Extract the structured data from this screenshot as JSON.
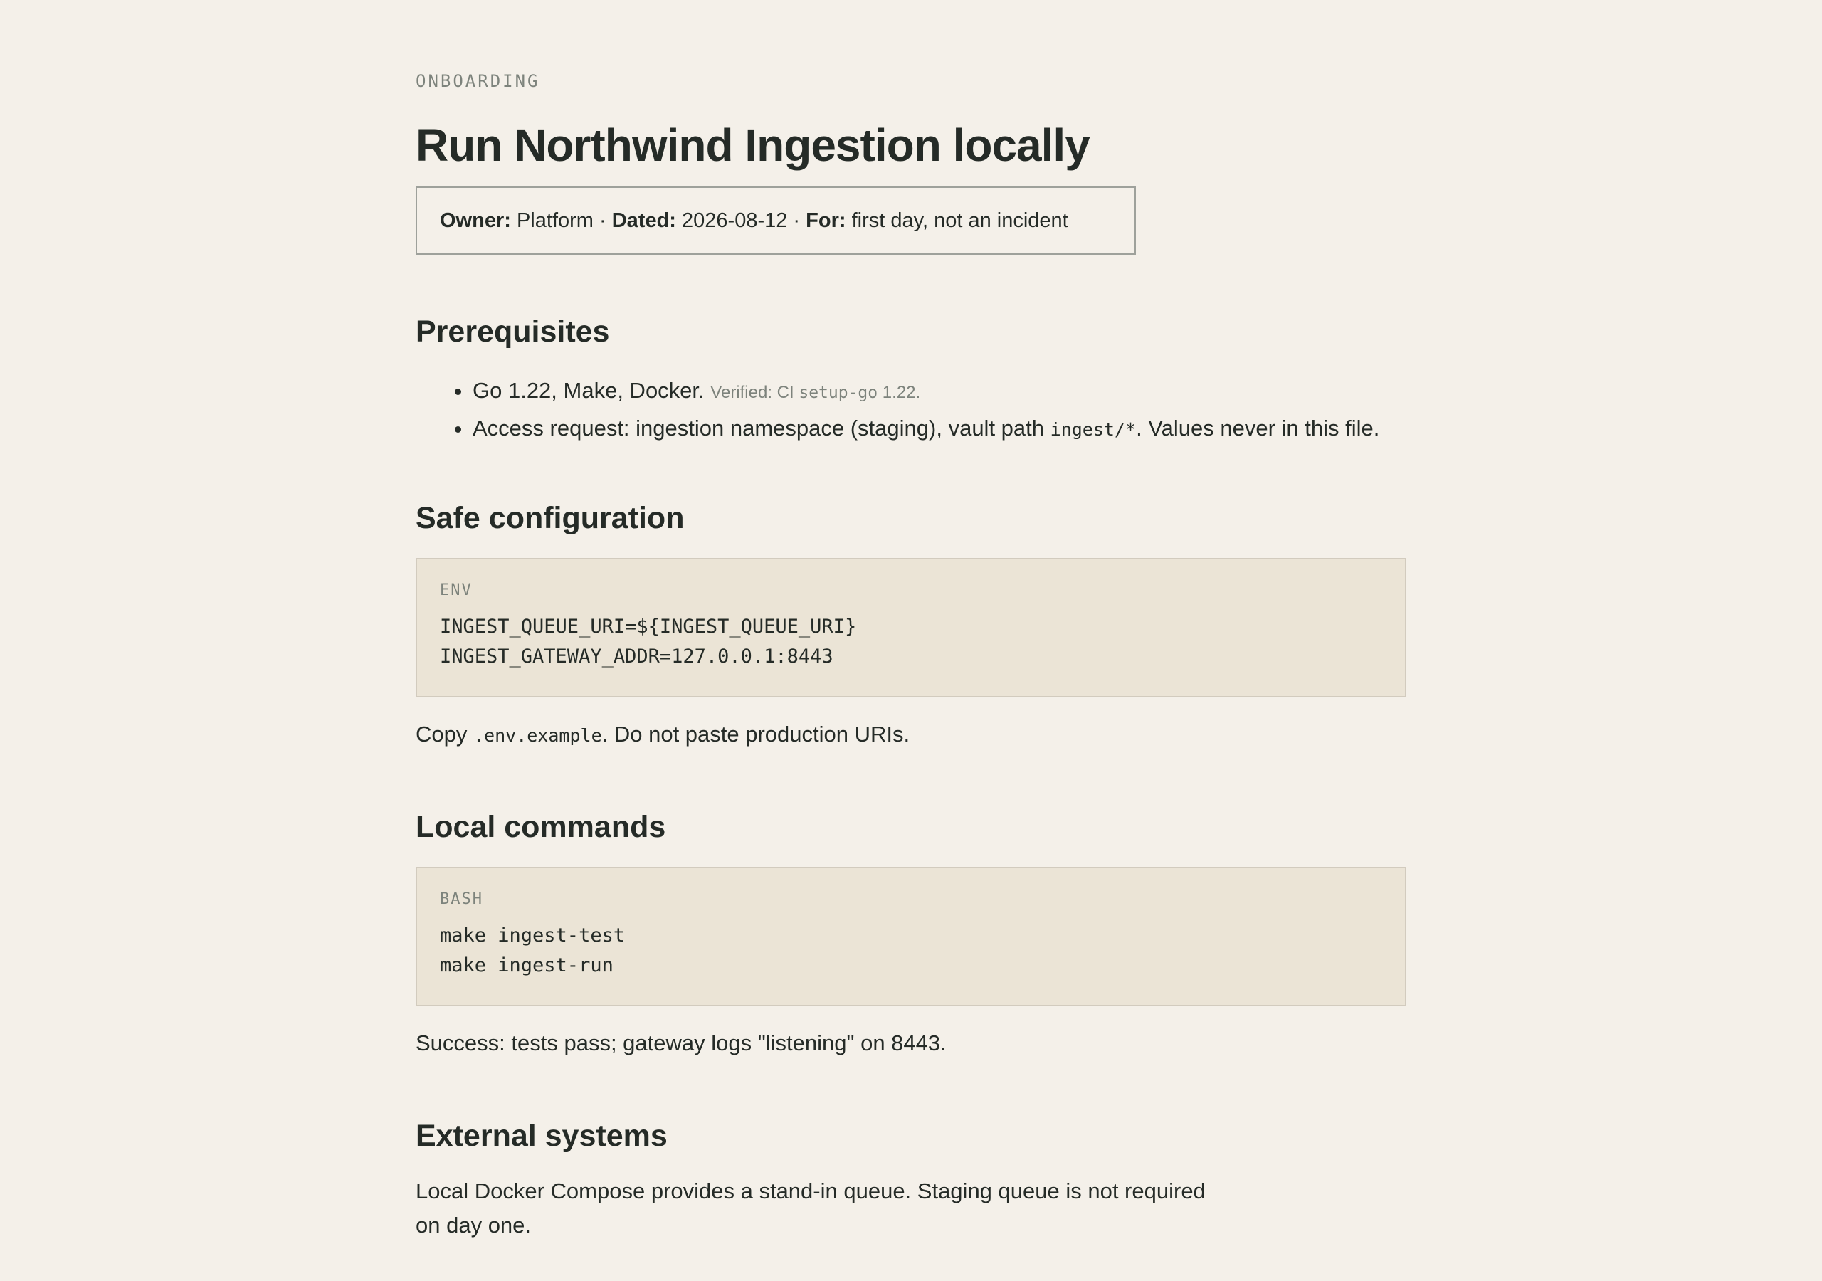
{
  "eyebrow": "ONBOARDING",
  "title": "Run Northwind Ingestion locally",
  "meta": {
    "owner_label": "Owner:",
    "owner_value": "Platform",
    "dated_label": "Dated:",
    "dated_value": "2026-08-12",
    "for_label": "For:",
    "for_value": "first day, not an incident",
    "separator": " · "
  },
  "prerequisites": {
    "heading": "Prerequisites",
    "item1_text": "Go 1.22, Make, Docker.",
    "item1_note_prefix": "Verified: CI",
    "item1_note_code": "setup-go",
    "item1_note_suffix": "1.22.",
    "item2_prefix": "Access request: ingestion namespace (staging), vault path",
    "item2_code": "ingest/*",
    "item2_suffix": ". Values never in this file."
  },
  "safe_config": {
    "heading": "Safe configuration",
    "block_lang": "ENV",
    "block_line1": "INGEST_QUEUE_URI=${INGEST_QUEUE_URI}",
    "block_line2": "INGEST_GATEWAY_ADDR=127.0.0.1:8443",
    "after_prefix": "Copy",
    "after_code": ".env.example",
    "after_suffix": ". Do not paste production URIs."
  },
  "local_commands": {
    "heading": "Local commands",
    "block_lang": "BASH",
    "block_line1": "make ingest-test",
    "block_line2": "make ingest-run",
    "after_text": "Success: tests pass; gateway logs \"listening\" on 8443."
  },
  "external_systems": {
    "heading": "External systems",
    "line1": "Local Docker Compose provides a stand-in queue. Staging queue is not required",
    "line2": "on day one."
  }
}
